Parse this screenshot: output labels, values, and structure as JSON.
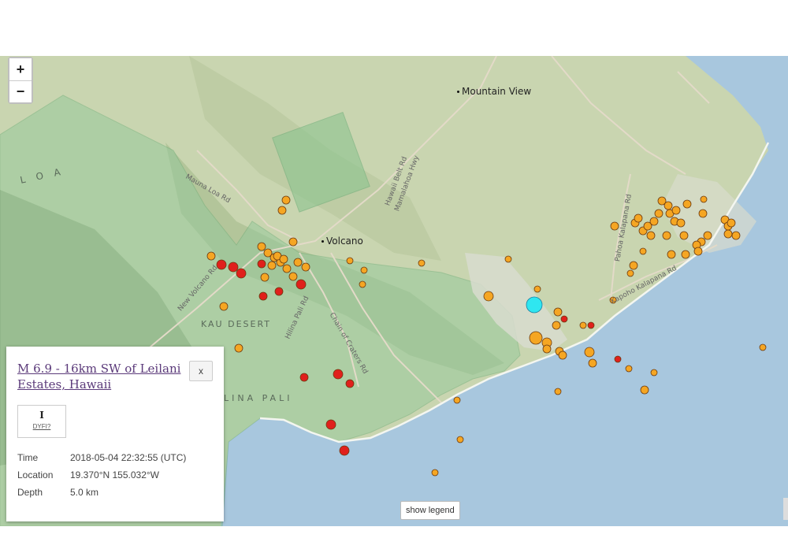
{
  "map": {
    "places": [
      {
        "name": "Mountain View"
      },
      {
        "name": "Volcano"
      }
    ],
    "regions": [
      "L O A",
      "KAU DESERT",
      "LINA PALI"
    ],
    "roads": [
      "Mauna Loa Rd",
      "Hawaii Belt Rd",
      "Mamalahoa Hwy",
      "New Volcano Rd",
      "Hilina Pali Rd",
      "Chain of Craters Rd",
      "Pahoa Kalapana Rd",
      "Kapoho Kalapana Rd"
    ],
    "colors": {
      "ocean": "#a8c7de",
      "land": "#c8d4ae",
      "park": "#9fcca1",
      "recent_event": "#e0201c",
      "older_event": "#f5a623",
      "selected_event": "#2fe6f0"
    },
    "zoom_in_label": "+",
    "zoom_out_label": "−",
    "show_legend_label": "show legend"
  },
  "popup": {
    "title": "M 6.9 - 16km SW of Leilani Estates, Hawaii",
    "close_label": "x",
    "dyfi_value": "I",
    "dyfi_label": "DYFI?",
    "details": [
      {
        "key": "Time",
        "value": "2018-05-04 22:32:55 (UTC)"
      },
      {
        "key": "Location",
        "value": "19.370°N 155.032°W"
      },
      {
        "key": "Depth",
        "value": "5.0 km"
      }
    ]
  }
}
